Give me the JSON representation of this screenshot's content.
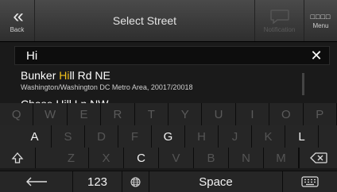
{
  "header": {
    "back_label": "Back",
    "title": "Select Street",
    "notifications_label": "Notification",
    "menu_label": "Menu"
  },
  "search": {
    "value": "Hi"
  },
  "results": [
    {
      "name_pre": "Bunker ",
      "name_match": "Hi",
      "name_post": "ll Rd NE",
      "sub": "Washington/Washington DC Metro Area, 20017/20018"
    },
    {
      "name_partial": "Chase Hill Ln NW"
    }
  ],
  "keyboard": {
    "row1": [
      "Q",
      "W",
      "E",
      "R",
      "T",
      "Y",
      "U",
      "I",
      "O",
      "P"
    ],
    "row2": [
      "A",
      "S",
      "D",
      "F",
      "G",
      "H",
      "J",
      "K",
      "L"
    ],
    "row2_active": [
      "A",
      "G",
      "L"
    ],
    "row3": [
      "Z",
      "X",
      "C",
      "V",
      "B",
      "N",
      "M"
    ],
    "row3_active": [
      "C"
    ],
    "numbers_label": "123",
    "space_label": "Space"
  },
  "colors": {
    "highlight": "#f2c21b",
    "active_key": "#f2f2f2",
    "inactive_key": "#555555"
  }
}
